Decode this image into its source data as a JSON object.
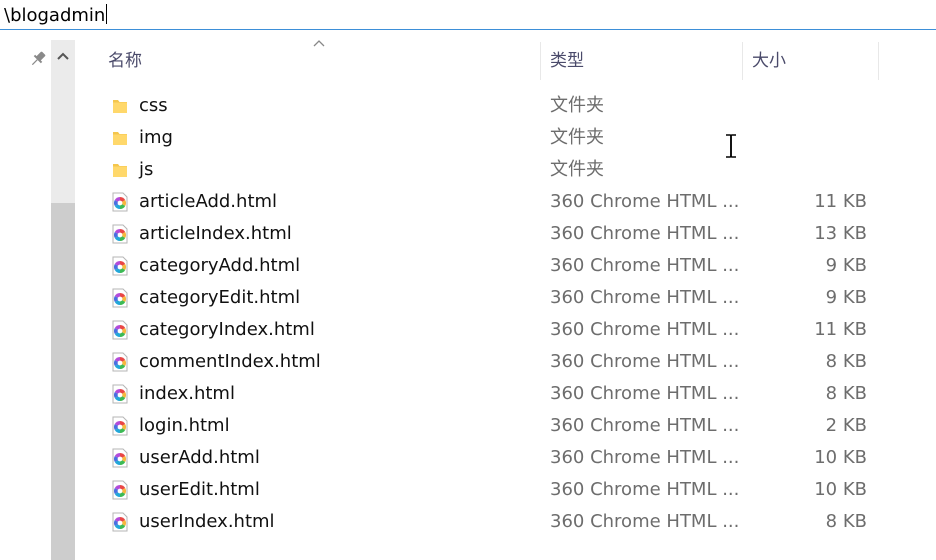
{
  "address_bar": {
    "path": "\\blogadmin"
  },
  "columns": {
    "name": "名称",
    "type": "类型",
    "size": "大小"
  },
  "colors": {
    "accent": "#3d8fd8",
    "folder": "#f4c64d",
    "text_secondary": "#6d6d6d"
  },
  "items": [
    {
      "name": "css",
      "type": "文件夹",
      "size": "",
      "icon": "folder-icon"
    },
    {
      "name": "img",
      "type": "文件夹",
      "size": "",
      "icon": "folder-icon"
    },
    {
      "name": "js",
      "type": "文件夹",
      "size": "",
      "icon": "folder-icon"
    },
    {
      "name": "articleAdd.html",
      "type": "360 Chrome HTML ...",
      "size": "11 KB",
      "icon": "html-file-icon"
    },
    {
      "name": "articleIndex.html",
      "type": "360 Chrome HTML ...",
      "size": "13 KB",
      "icon": "html-file-icon"
    },
    {
      "name": "categoryAdd.html",
      "type": "360 Chrome HTML ...",
      "size": "9 KB",
      "icon": "html-file-icon"
    },
    {
      "name": "categoryEdit.html",
      "type": "360 Chrome HTML ...",
      "size": "9 KB",
      "icon": "html-file-icon"
    },
    {
      "name": "categoryIndex.html",
      "type": "360 Chrome HTML ...",
      "size": "11 KB",
      "icon": "html-file-icon"
    },
    {
      "name": "commentIndex.html",
      "type": "360 Chrome HTML ...",
      "size": "8 KB",
      "icon": "html-file-icon"
    },
    {
      "name": "index.html",
      "type": "360 Chrome HTML ...",
      "size": "8 KB",
      "icon": "html-file-icon"
    },
    {
      "name": "login.html",
      "type": "360 Chrome HTML ...",
      "size": "2 KB",
      "icon": "html-file-icon"
    },
    {
      "name": "userAdd.html",
      "type": "360 Chrome HTML ...",
      "size": "10 KB",
      "icon": "html-file-icon"
    },
    {
      "name": "userEdit.html",
      "type": "360 Chrome HTML ...",
      "size": "10 KB",
      "icon": "html-file-icon"
    },
    {
      "name": "userIndex.html",
      "type": "360 Chrome HTML ...",
      "size": "8 KB",
      "icon": "html-file-icon"
    }
  ]
}
